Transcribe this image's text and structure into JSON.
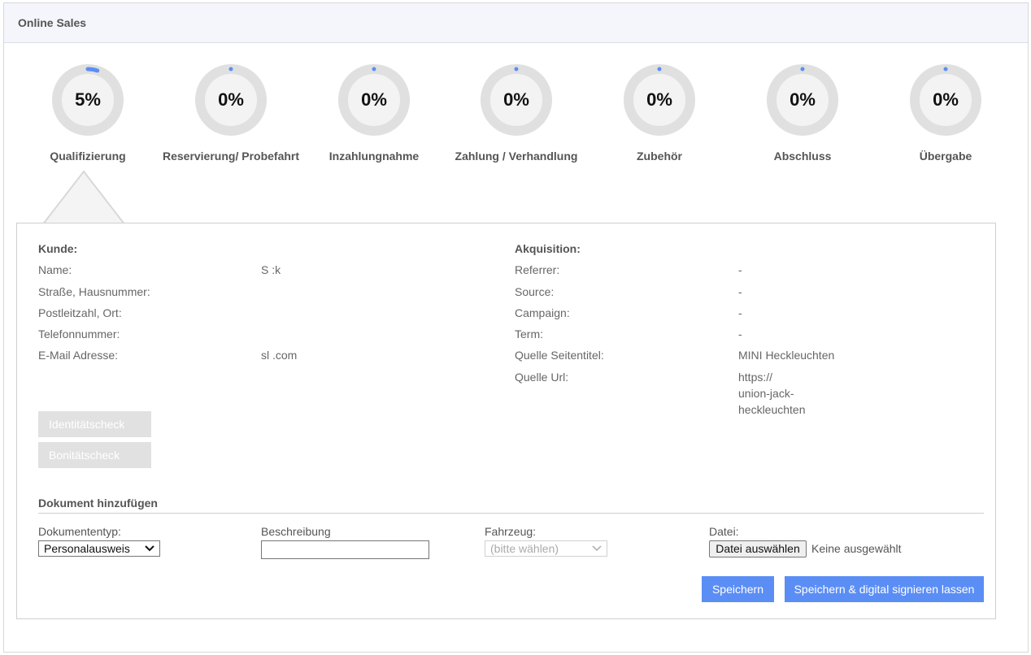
{
  "header": {
    "title": "Online Sales"
  },
  "steps": [
    {
      "percent": "5%",
      "progress": 0.05,
      "label": "Qualifizierung"
    },
    {
      "percent": "0%",
      "progress": 0,
      "label": "Reservierung/ Probefahrt"
    },
    {
      "percent": "0%",
      "progress": 0,
      "label": "Inzahlungnahme"
    },
    {
      "percent": "0%",
      "progress": 0,
      "label": "Zahlung / Verhandlung"
    },
    {
      "percent": "0%",
      "progress": 0,
      "label": "Zubehör"
    },
    {
      "percent": "0%",
      "progress": 0,
      "label": "Abschluss"
    },
    {
      "percent": "0%",
      "progress": 0,
      "label": "Übergabe"
    }
  ],
  "colors": {
    "accent": "#5b8ef5",
    "ring_track": "#e0e0e0",
    "ring_inner": "#f3f3f3"
  },
  "customer": {
    "title": "Kunde:",
    "rows": [
      {
        "label": "Name:",
        "value": "S          :k"
      },
      {
        "label": "Straße, Hausnummer:",
        "value": ""
      },
      {
        "label": "Postleitzahl, Ort:",
        "value": ""
      },
      {
        "label": "Telefonnummer:",
        "value": ""
      },
      {
        "label": "E-Mail Adresse:",
        "value": "sl                              .com"
      }
    ]
  },
  "acquisition": {
    "title": "Akquisition:",
    "rows": [
      {
        "label": "Referrer:",
        "value": "-"
      },
      {
        "label": "Source:",
        "value": "-"
      },
      {
        "label": "Campaign:",
        "value": "-"
      },
      {
        "label": "Term:",
        "value": "-"
      },
      {
        "label": "Quelle Seitentitel:",
        "value": "MINI                  Heckleuchten"
      },
      {
        "label": "Quelle Url:",
        "value_lines": [
          "https://",
          "                                    union-jack-",
          "heckleuchten"
        ]
      }
    ]
  },
  "checks": {
    "identity": "Identitätscheck",
    "credit": "Bonitätscheck"
  },
  "document": {
    "title": "Dokument hinzufügen",
    "type_label": "Dokumententyp:",
    "type_value": "Personalausweis",
    "description_label": "Beschreibung",
    "vehicle_label": "Fahrzeug:",
    "vehicle_value": "(bitte wählen)",
    "file_label": "Datei:",
    "file_button": "Datei auswählen",
    "file_status": "Keine ausgewählt",
    "save_button": "Speichern",
    "save_sign_button": "Speichern & digital signieren lassen"
  }
}
